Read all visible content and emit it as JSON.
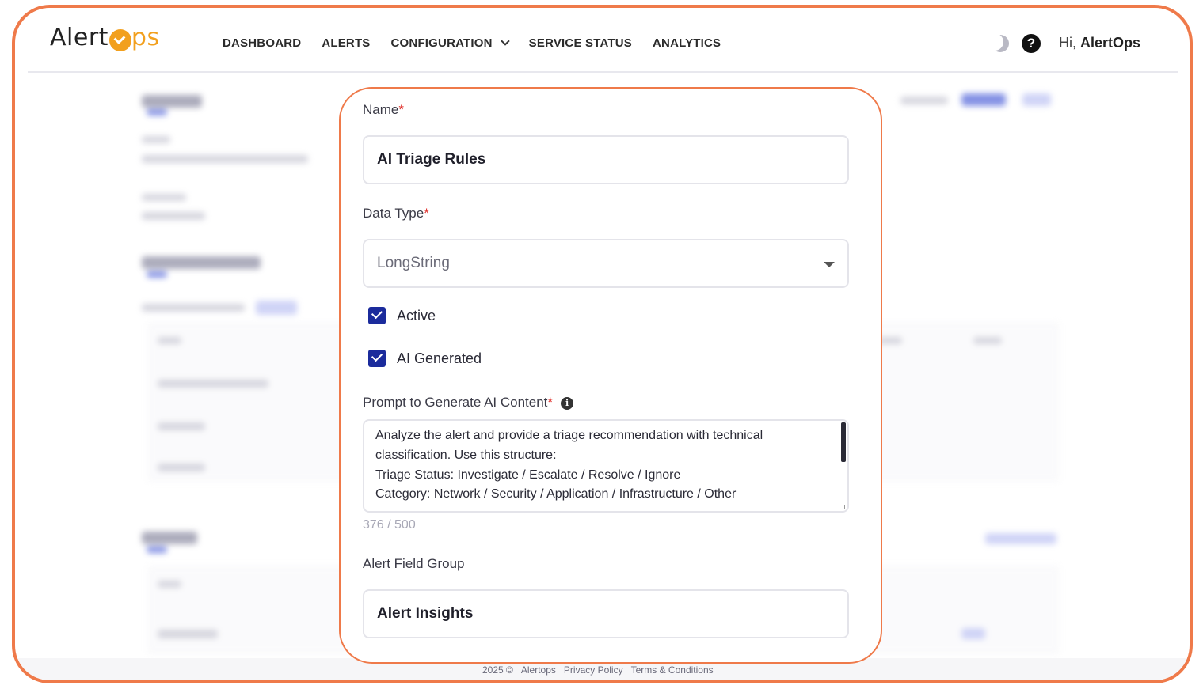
{
  "app": {
    "logo": {
      "text_a": "Alert",
      "text_b": "ps",
      "brand_color": "#f2a01e"
    },
    "frame_color": "#ef7a4a"
  },
  "nav": {
    "items": [
      {
        "label": "DASHBOARD"
      },
      {
        "label": "ALERTS"
      },
      {
        "label": "CONFIGURATION",
        "has_dropdown": true
      },
      {
        "label": "SERVICE STATUS"
      },
      {
        "label": "ANALYTICS"
      }
    ],
    "theme_icon": "moon-icon",
    "help_icon": "help-icon",
    "greeting_prefix": "Hi,",
    "user_name": "AlertOps"
  },
  "form": {
    "name": {
      "label": "Name",
      "required_mark": "*",
      "value": "AI Triage Rules"
    },
    "data_type": {
      "label": "Data Type",
      "required_mark": "*",
      "value": "LongString"
    },
    "active": {
      "label": "Active",
      "checked": true
    },
    "ai_generated": {
      "label": "AI Generated",
      "checked": true
    },
    "prompt": {
      "label": "Prompt to Generate AI Content",
      "required_mark": "*",
      "lines": [
        "Analyze the alert and provide a triage recommendation with technical",
        "classification. Use this structure:",
        "Triage Status: Investigate / Escalate / Resolve / Ignore",
        "Category: Network / Security / Application / Infrastructure / Other"
      ],
      "counter": "376 / 500"
    },
    "field_group": {
      "label": "Alert Field Group",
      "value": "Alert Insights"
    }
  },
  "footer": {
    "copyright": "2025 ©",
    "brand": "Alertops",
    "privacy": "Privacy Policy",
    "terms": "Terms & Conditions"
  }
}
